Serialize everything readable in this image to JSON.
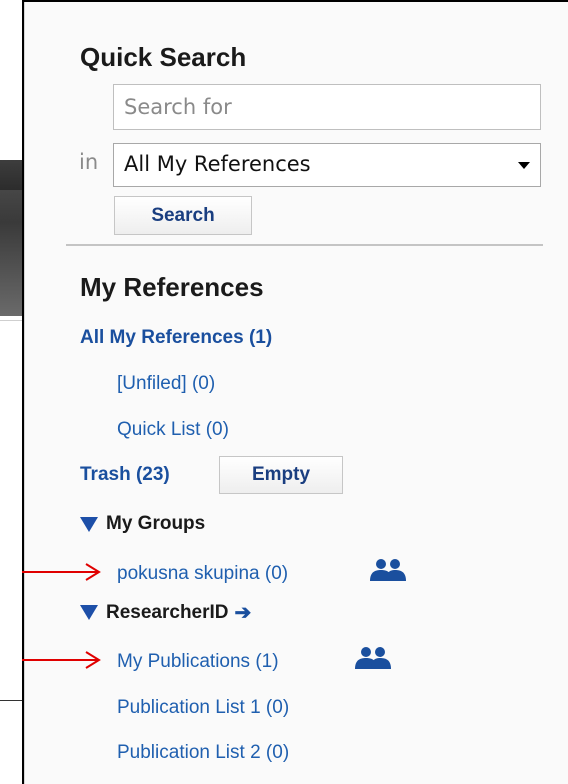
{
  "quick_search": {
    "title": "Quick Search",
    "search_placeholder": "Search for",
    "in_label": "in",
    "scope_selected": "All My References",
    "search_button": "Search"
  },
  "my_references": {
    "title": "My References",
    "all_refs": "All My References (1)",
    "unfiled": "[Unfiled] (0)",
    "quick_list": "Quick List (0)",
    "trash": "Trash (23)",
    "empty_button": "Empty"
  },
  "groups": {
    "title": "My Groups",
    "items": [
      {
        "label": "pokusna skupina (0)"
      }
    ]
  },
  "researcherid": {
    "title": "ResearcherID",
    "items": [
      {
        "label": "My Publications (1)"
      },
      {
        "label": "Publication List 1 (0)"
      },
      {
        "label": "Publication List 2 (0)"
      }
    ]
  },
  "colors": {
    "link": "#1f5faf",
    "section_triangle": "#1d4fa8",
    "annotation_arrow": "#e00000",
    "group_icon": "#1a4f9e"
  },
  "icons": [
    "group-icon",
    "triangle-down-icon",
    "arrow-right-icon",
    "dropdown-caret-icon"
  ]
}
